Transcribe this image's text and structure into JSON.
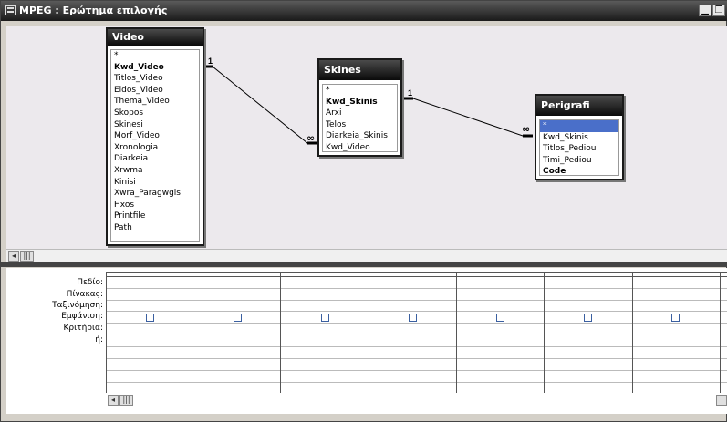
{
  "window": {
    "title": "MPEG : Ερώτημα επιλογής",
    "minimize_glyph": "▁",
    "restore_glyph": "❐"
  },
  "tables": [
    {
      "name": "Video",
      "fields": [
        "*",
        "Kwd_Video",
        "Titlos_Video",
        "Eidos_Video",
        "Thema_Video",
        "Skopos",
        "Skinesi",
        "Morf_Video",
        "Xronologia",
        "Diarkeia",
        "Xrwma",
        "Kinisi",
        "Xwra_Paragwgis",
        "Hxos",
        "Printfile",
        "Path"
      ],
      "key_field": "Kwd_Video"
    },
    {
      "name": "Skines",
      "fields": [
        "*",
        "Kwd_Skinis",
        "Arxi",
        "Telos",
        "Diarkeia_Skinis",
        "Kwd_Video"
      ],
      "key_field": "Kwd_Skinis"
    },
    {
      "name": "Perigrafi",
      "fields": [
        "*",
        "Kwd_Skinis",
        "Titlos_Pediou",
        "Timi_Pediou",
        "Code"
      ],
      "key_field": "Code",
      "selected_field": "*"
    }
  ],
  "relations": [
    {
      "from": "Video",
      "to": "Skines",
      "one_label": "1",
      "many_label": "∞"
    },
    {
      "from": "Skines",
      "to": "Perigrafi",
      "one_label": "1",
      "many_label": "∞"
    }
  ],
  "grid": {
    "row_labels": [
      "Πεδίο:",
      "Πίνακας:",
      "Ταξινόμηση:",
      "Εμφάνιση:",
      "Κριτήρια:",
      "ή:"
    ],
    "columns": 7
  },
  "scroll_glyph_left": "◂",
  "scroll_grip": "|||"
}
